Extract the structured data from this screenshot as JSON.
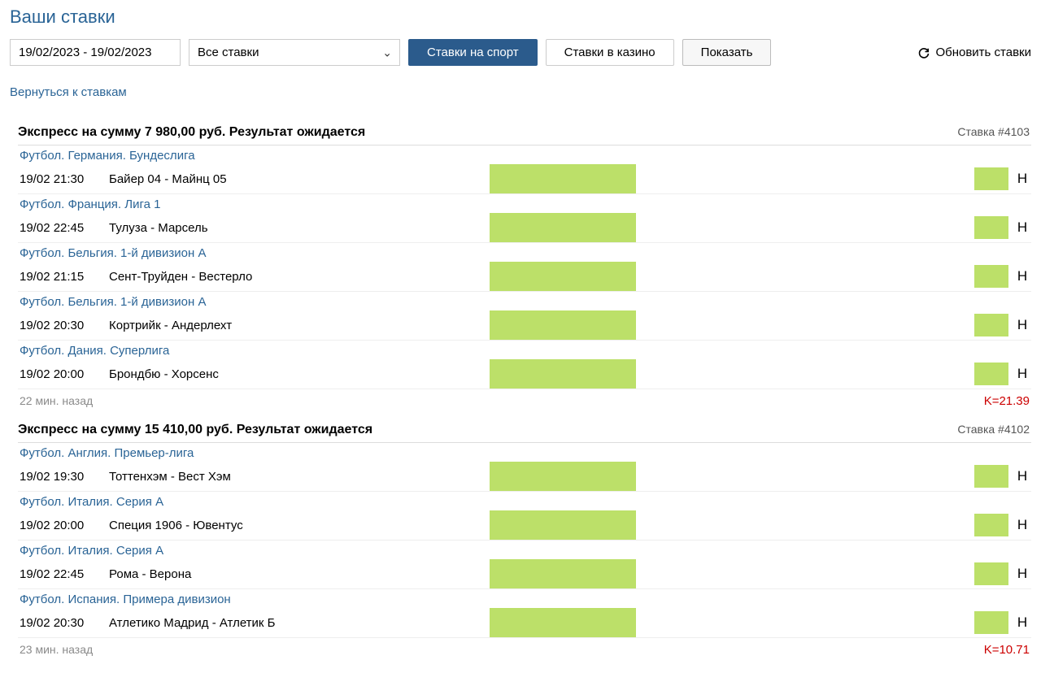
{
  "page_title": "Ваши ставки",
  "filters": {
    "date_range": "19/02/2023 - 19/02/2023",
    "bet_filter": "Все ставки",
    "tab_sport": "Ставки на спорт",
    "tab_casino": "Ставки в казино",
    "show_btn": "Показать",
    "refresh": "Обновить ставки"
  },
  "back_link": "Вернуться к ставкам",
  "bets": [
    {
      "title": "Экспресс на сумму 7 980,00 руб. Результат ожидается",
      "id": "Ставка #4103",
      "events": [
        {
          "league": "Футбол. Германия. Бундеслига",
          "time": "19/02 21:30",
          "match": "Байер 04 - Майнц 05",
          "status": "Н"
        },
        {
          "league": "Футбол. Франция. Лига 1",
          "time": "19/02 22:45",
          "match": "Тулуза - Марсель",
          "status": "Н"
        },
        {
          "league": "Футбол. Бельгия. 1-й дивизион А",
          "time": "19/02 21:15",
          "match": "Сент-Труйден - Вестерло",
          "status": "Н"
        },
        {
          "league": "Футбол. Бельгия. 1-й дивизион А",
          "time": "19/02 20:30",
          "match": "Кортрийк - Андерлехт",
          "status": "Н"
        },
        {
          "league": "Футбол. Дания. Суперлига",
          "time": "19/02 20:00",
          "match": "Брондбю - Хорсенс",
          "status": "Н"
        }
      ],
      "time_ago": "22 мин. назад",
      "coef": "K=21.39"
    },
    {
      "title": "Экспресс на сумму 15 410,00 руб. Результат ожидается",
      "id": "Ставка #4102",
      "events": [
        {
          "league": "Футбол. Англия. Премьер-лига",
          "time": "19/02 19:30",
          "match": "Тоттенхэм - Вест Хэм",
          "status": "Н"
        },
        {
          "league": "Футбол. Италия. Серия А",
          "time": "19/02 20:00",
          "match": "Специя 1906 - Ювентус",
          "status": "Н"
        },
        {
          "league": "Футбол. Италия. Серия А",
          "time": "19/02 22:45",
          "match": "Рома - Верона",
          "status": "Н"
        },
        {
          "league": "Футбол. Испания. Примера дивизион",
          "time": "19/02 20:30",
          "match": "Атлетико Мадрид - Атлетик Б",
          "status": "Н"
        }
      ],
      "time_ago": "23 мин. назад",
      "coef": "K=10.71"
    }
  ]
}
